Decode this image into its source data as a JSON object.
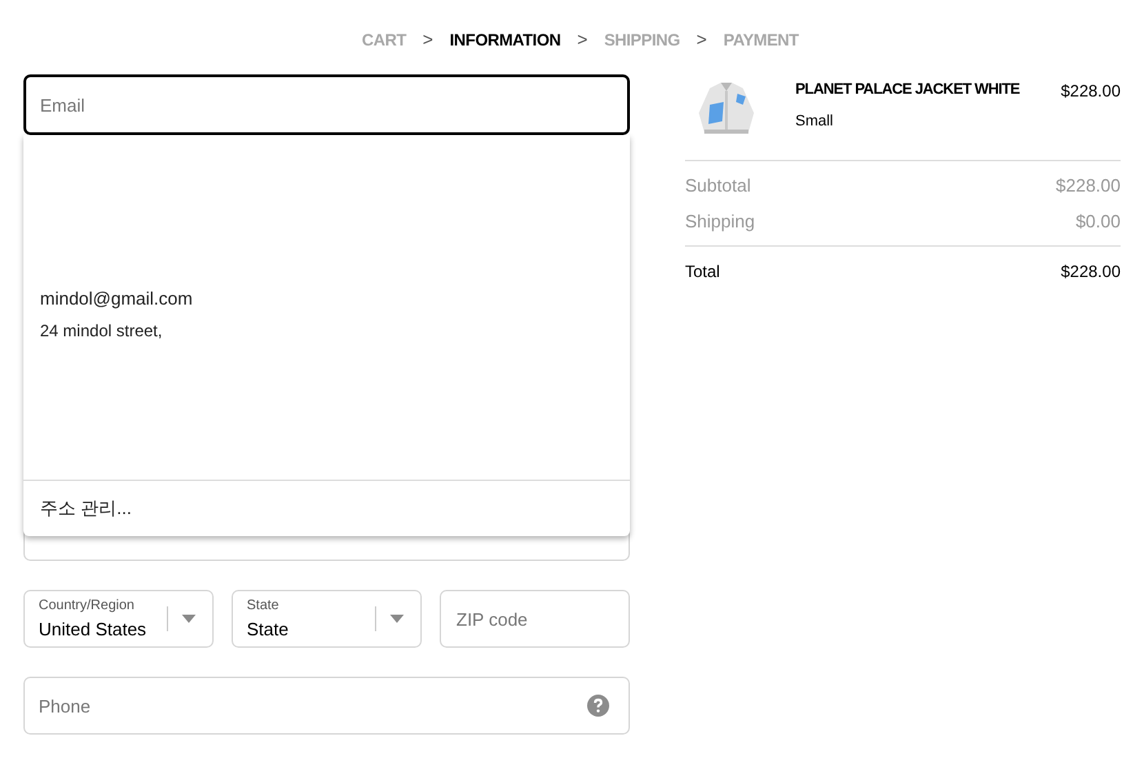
{
  "breadcrumb": [
    {
      "label": "CART",
      "selected": false
    },
    {
      "label": "INFORMATION",
      "selected": true
    },
    {
      "label": "SHIPPING",
      "selected": false
    },
    {
      "label": "PAYMENT",
      "selected": false
    }
  ],
  "breadcrumb_separator": ">",
  "email_field": {
    "placeholder": "Email"
  },
  "autofill": {
    "entries": [
      {
        "email": "mindol@gmail.com",
        "address": "24 mindol street,"
      }
    ],
    "footer": "주소 관리..."
  },
  "address_row": [
    {
      "kind": "select",
      "label": "Country/Region",
      "value": "United States"
    },
    {
      "kind": "select",
      "label": "State",
      "value": "State"
    },
    {
      "kind": "input",
      "placeholder": "ZIP code"
    }
  ],
  "phone_field": {
    "placeholder": "Phone"
  },
  "order": {
    "items": [
      {
        "name": "PLANET PALACE JACKET WHITE",
        "variant": "Small",
        "price": "$228.00"
      }
    ],
    "lines": [
      {
        "label": "Subtotal",
        "value": "$228.00"
      },
      {
        "label": "Shipping",
        "value": "$0.00"
      }
    ],
    "total": {
      "label": "Total",
      "value": "$228.00"
    }
  }
}
